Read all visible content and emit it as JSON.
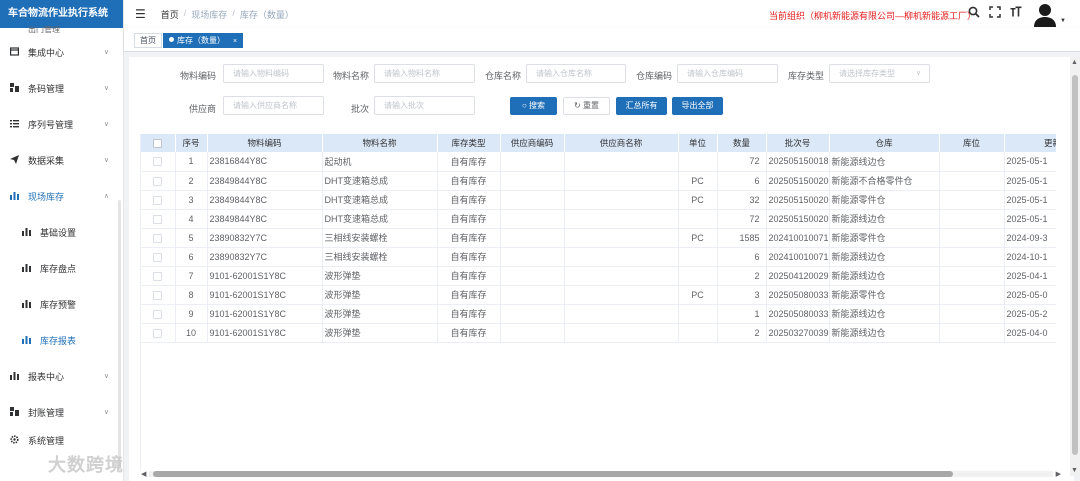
{
  "app_title": "车合物流作业执行系统",
  "sidebar": {
    "top_partial": "出门管理",
    "items": [
      {
        "label": "集成中心",
        "icon": "window-icon"
      },
      {
        "label": "条码管理",
        "icon": "barcode-icon"
      },
      {
        "label": "序列号管理",
        "icon": "list-icon"
      },
      {
        "label": "数据采集",
        "icon": "send-icon"
      },
      {
        "label": "现场库存",
        "icon": "bar-chart-icon",
        "active": true
      },
      {
        "label": "基础设置",
        "icon": "bar-chart-icon",
        "sub": true
      },
      {
        "label": "库存盘点",
        "icon": "bar-chart-icon",
        "sub": true
      },
      {
        "label": "库存预警",
        "icon": "bar-chart-icon",
        "sub": true
      },
      {
        "label": "库存报表",
        "icon": "bar-chart-icon",
        "sub": true,
        "current": true
      },
      {
        "label": "报表中心",
        "icon": "bar-chart-icon"
      },
      {
        "label": "封账管理",
        "icon": "barcode-icon"
      },
      {
        "label": "系统管理",
        "icon": "gear-icon"
      }
    ],
    "watermark": "大数跨境"
  },
  "header": {
    "breadcrumb": [
      "首页",
      "现场库存",
      "库存（数量）"
    ],
    "org": "当前组织（柳机新能源有限公司—柳机新能源工厂）"
  },
  "tabs": [
    {
      "label": "首页",
      "active": false
    },
    {
      "label": "库存（数量）",
      "active": true
    }
  ],
  "filters": {
    "material_code": {
      "label": "物料编码",
      "placeholder": "请输入物料编码"
    },
    "material_name": {
      "label": "物料名称",
      "placeholder": "请输入物料名称"
    },
    "warehouse_name": {
      "label": "仓库名称",
      "placeholder": "请输入仓库名称"
    },
    "warehouse_code": {
      "label": "仓库编码",
      "placeholder": "请输入仓库编码"
    },
    "stock_type": {
      "label": "库存类型",
      "placeholder": "请选择库存类型"
    },
    "supplier": {
      "label": "供应商",
      "placeholder": "请输入供应商名称"
    },
    "batch": {
      "label": "批次",
      "placeholder": "请输入批次"
    }
  },
  "buttons": {
    "search": "搜索",
    "reset": "重置",
    "summary": "汇总所有",
    "export": "导出全部"
  },
  "table": {
    "headers": [
      "",
      "序号",
      "物料编码",
      "物料名称",
      "库存类型",
      "供应商编码",
      "供应商名称",
      "单位",
      "数量",
      "批次号",
      "仓库",
      "库位",
      "更新"
    ],
    "rows": [
      [
        "1",
        "23816844Y8C",
        "起动机",
        "自有库存",
        "",
        "",
        "",
        "72",
        "202505150018",
        "新能源线边仓",
        "",
        "2025-05-1"
      ],
      [
        "2",
        "23849844Y8C",
        "DHT变速箱总成",
        "自有库存",
        "",
        "",
        "PC",
        "6",
        "202505150020",
        "新能源不合格零件仓",
        "",
        "2025-05-1"
      ],
      [
        "3",
        "23849844Y8C",
        "DHT变速箱总成",
        "自有库存",
        "",
        "",
        "PC",
        "32",
        "202505150020",
        "新能源零件仓",
        "",
        "2025-05-1"
      ],
      [
        "4",
        "23849844Y8C",
        "DHT变速箱总成",
        "自有库存",
        "",
        "",
        "",
        "72",
        "202505150020",
        "新能源线边仓",
        "",
        "2025-05-1"
      ],
      [
        "5",
        "23890832Y7C",
        "三相线安装螺栓",
        "自有库存",
        "",
        "",
        "PC",
        "1585",
        "202410010071",
        "新能源零件仓",
        "",
        "2024-09-3"
      ],
      [
        "6",
        "23890832Y7C",
        "三相线安装螺栓",
        "自有库存",
        "",
        "",
        "",
        "6",
        "202410010071",
        "新能源线边仓",
        "",
        "2024-10-1"
      ],
      [
        "7",
        "9101-62001S1Y8C",
        "波形弹垫",
        "自有库存",
        "",
        "",
        "",
        "2",
        "202504120029",
        "新能源线边仓",
        "",
        "2025-04-1"
      ],
      [
        "8",
        "9101-62001S1Y8C",
        "波形弹垫",
        "自有库存",
        "",
        "",
        "PC",
        "3",
        "202505080033",
        "新能源零件仓",
        "",
        "2025-05-0"
      ],
      [
        "9",
        "9101-62001S1Y8C",
        "波形弹垫",
        "自有库存",
        "",
        "",
        "",
        "1",
        "202505080033",
        "新能源线边仓",
        "",
        "2025-05-2"
      ],
      [
        "10",
        "9101-62001S1Y8C",
        "波形弹垫",
        "自有库存",
        "",
        "",
        "",
        "2",
        "202503270039",
        "新能源线边仓",
        "",
        "2025-04-0"
      ]
    ]
  },
  "colors": {
    "brand": "#1f6fb8",
    "org_text": "#e02020",
    "header_row": "#dbe8f8"
  }
}
